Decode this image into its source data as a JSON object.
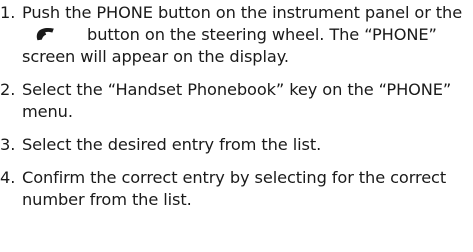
{
  "steps": [
    {
      "number": "1.",
      "text_before_icon": "Push the PHONE button on the instrument panel or the",
      "icon": "phone-handset-icon",
      "text_after_icon": "button on the steering wheel. The “PHONE” screen will appear on the display."
    },
    {
      "number": "2.",
      "text": "Select the “Handset Phonebook” key on the “PHONE” menu."
    },
    {
      "number": "3.",
      "text": "Select the desired entry from the list."
    },
    {
      "number": "4.",
      "text": "Confirm the correct entry by selecting for the correct number from the list."
    }
  ]
}
